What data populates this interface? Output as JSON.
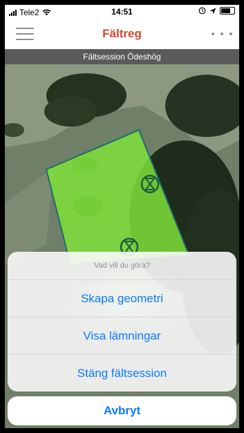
{
  "status_bar": {
    "carrier": "Tele2",
    "time": "14:51"
  },
  "nav": {
    "title": "Fältreg"
  },
  "session": {
    "name": "Fältsession Ödeshög"
  },
  "action_sheet": {
    "title": "Vad vill du göra?",
    "options": [
      "Skapa geometri",
      "Visa lämningar",
      "Stäng fältsession"
    ],
    "cancel": "Avbryt"
  },
  "colors": {
    "accent": "#d7472b",
    "link": "#0a7aff",
    "polygon": "#7fe03a"
  },
  "icons": [
    "signal-icon",
    "wifi-icon",
    "location-icon",
    "battery-icon",
    "menu-icon",
    "more-icon",
    "hourglass-icon"
  ]
}
